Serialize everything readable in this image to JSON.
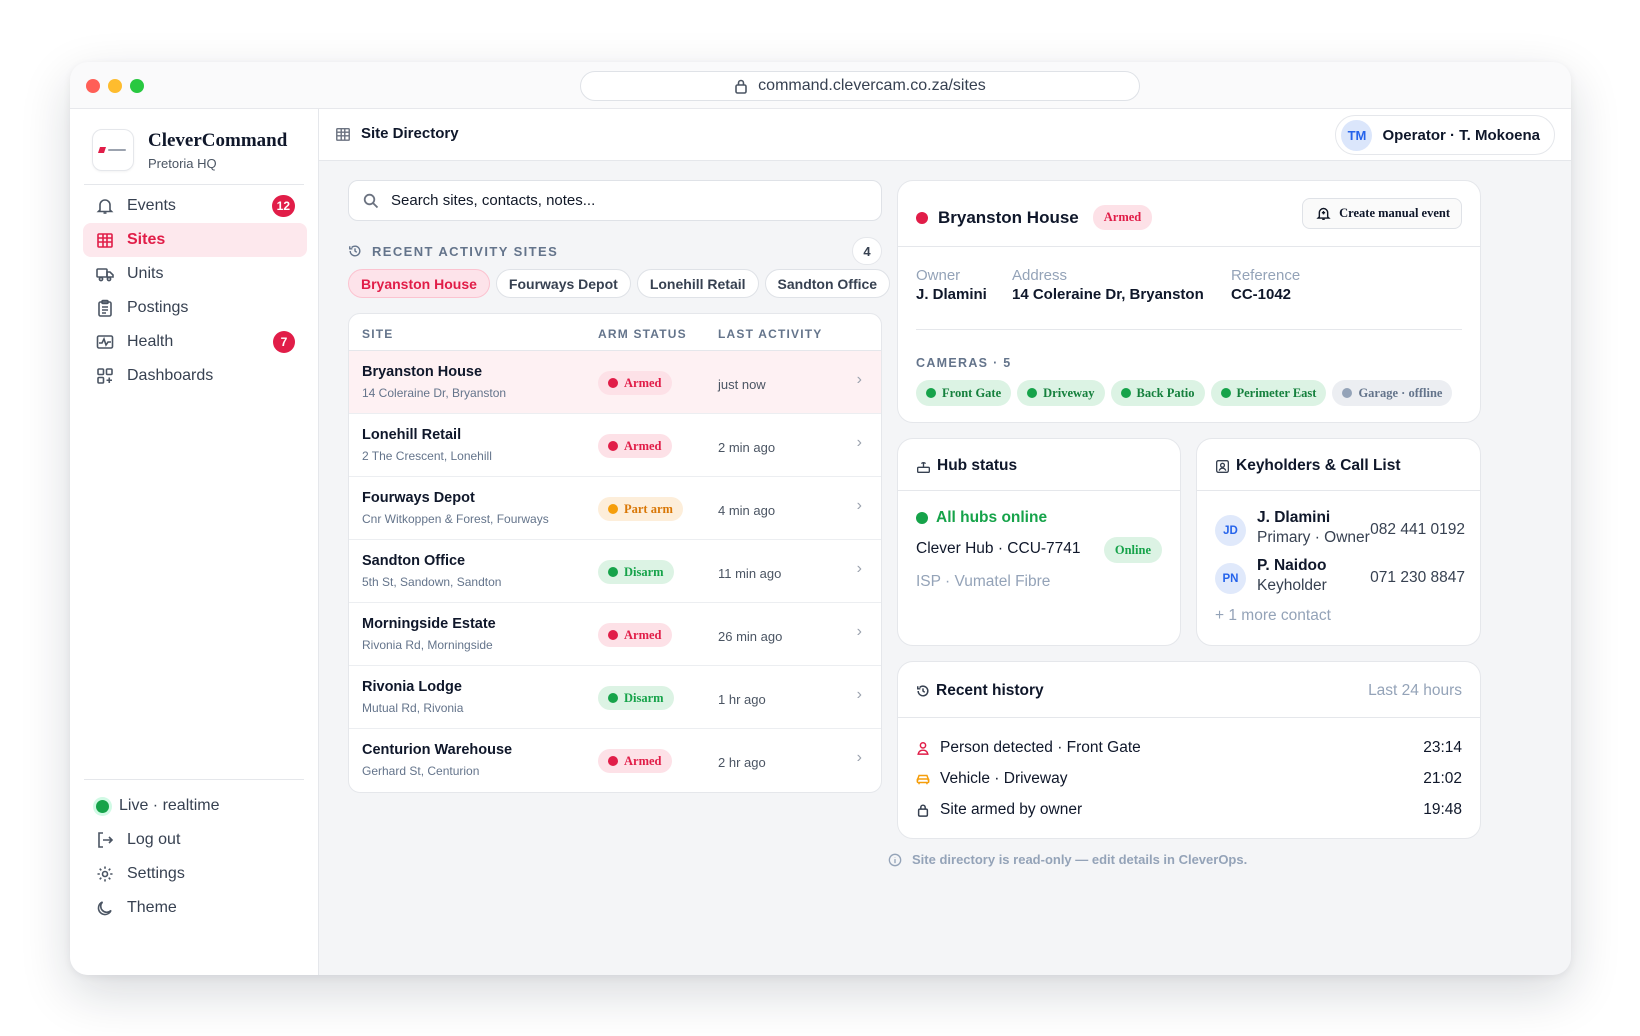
{
  "browser": {
    "url": "command.clevercam.co.za/sites"
  },
  "brand": {
    "name": "CleverCommand",
    "subtitle": "Pretoria HQ"
  },
  "nav": {
    "items": [
      {
        "label": "Events",
        "icon": "bell-icon",
        "badge": "12"
      },
      {
        "label": "Sites",
        "icon": "building-icon",
        "active": true
      },
      {
        "label": "Units",
        "icon": "truck-icon"
      },
      {
        "label": "Postings",
        "icon": "clipboard-icon"
      },
      {
        "label": "Health",
        "icon": "pulse-icon",
        "badge": "7"
      },
      {
        "label": "Dashboards",
        "icon": "grid-icon"
      }
    ],
    "bottom": [
      {
        "label": "Live · realtime",
        "icon": "live-dot"
      },
      {
        "label": "Log out",
        "icon": "logout-icon"
      },
      {
        "label": "Settings",
        "icon": "gear-icon"
      },
      {
        "label": "Theme",
        "icon": "moon-icon"
      }
    ]
  },
  "header": {
    "title": "Site Directory",
    "user_initials": "TM",
    "user_label": "Operator · T. Mokoena"
  },
  "search": {
    "placeholder": "Search sites, contacts, notes..."
  },
  "recent": {
    "heading": "RECENT ACTIVITY SITES",
    "count": "4",
    "chips": [
      "Bryanston House",
      "Fourways Depot",
      "Lonehill Retail",
      "Sandton Office"
    ]
  },
  "table": {
    "columns": [
      "SITE",
      "ARM STATUS",
      "LAST ACTIVITY"
    ],
    "rows": [
      {
        "name": "Bryanston House",
        "address": "14 Coleraine Dr, Bryanston",
        "status": "Armed",
        "time": "just now"
      },
      {
        "name": "Lonehill Retail",
        "address": "2 The Crescent, Lonehill",
        "status": "Armed",
        "time": "2 min ago"
      },
      {
        "name": "Fourways Depot",
        "address": "Cnr Witkoppen & Forest, Fourways",
        "status": "Part arm",
        "time": "4 min ago"
      },
      {
        "name": "Sandton Office",
        "address": "5th St, Sandown, Sandton",
        "status": "Disarm",
        "time": "11 min ago"
      },
      {
        "name": "Morningside Estate",
        "address": "Rivonia Rd, Morningside",
        "status": "Armed",
        "time": "26 min ago"
      },
      {
        "name": "Rivonia Lodge",
        "address": "Mutual Rd, Rivonia",
        "status": "Disarm",
        "time": "1 hr ago"
      },
      {
        "name": "Centurion Warehouse",
        "address": "Gerhard St, Centurion",
        "status": "Armed",
        "time": "2 hr ago"
      }
    ]
  },
  "detail": {
    "name": "Bryanston House",
    "status": "Armed",
    "action_label": "Create manual event",
    "owner_label": "Owner",
    "owner": "J. Dlamini",
    "address_label": "Address",
    "address": "14 Coleraine Dr, Bryanston",
    "reference_label": "Reference",
    "reference": "CC-1042",
    "cameras_heading": "CAMERAS · 5",
    "cameras": [
      {
        "label": "Front Gate",
        "online": true
      },
      {
        "label": "Driveway",
        "online": true
      },
      {
        "label": "Back Patio",
        "online": true
      },
      {
        "label": "Perimeter East",
        "online": true
      },
      {
        "label": "Garage · offline",
        "online": false
      }
    ]
  },
  "hub": {
    "title": "Hub status",
    "status": "All hubs online",
    "hub_name": "Clever Hub · CCU-7741",
    "hub_badge": "Online",
    "isp": "ISP · Vumatel Fibre"
  },
  "keyholders": {
    "title": "Keyholders & Call List",
    "contacts": [
      {
        "initials": "JD",
        "name": "J. Dlamini",
        "role": "Primary · Owner",
        "phone": "082 441 0192"
      },
      {
        "initials": "PN",
        "name": "P. Naidoo",
        "role": "Keyholder",
        "phone": "071 230 8847"
      }
    ],
    "more": "+ 1 more contact"
  },
  "history": {
    "title": "Recent history",
    "range": "Last 24 hours",
    "items": [
      {
        "icon": "person-icon",
        "text": "Person detected · Front Gate",
        "time": "23:14"
      },
      {
        "icon": "car-icon",
        "text": "Vehicle · Driveway",
        "time": "21:02"
      },
      {
        "icon": "lock-icon",
        "text": "Site armed by owner",
        "time": "19:48"
      }
    ]
  },
  "footer_note": "Site directory is read-only — edit details in CleverOps.",
  "colors": {
    "accent": "#e11d48",
    "armed": "#e11d48",
    "part_arm": "#f59e0b",
    "disarm": "#16a34a",
    "info": "#2563eb"
  }
}
